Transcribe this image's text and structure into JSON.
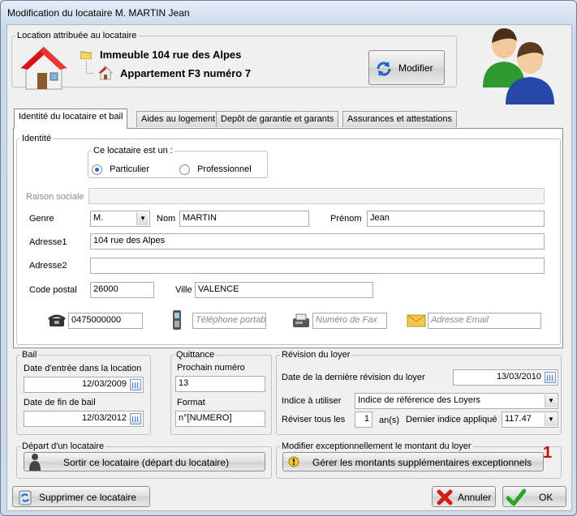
{
  "window": {
    "title": "Modification du locataire M. MARTIN Jean"
  },
  "location": {
    "legend": "Location attribuée au locataire",
    "building": "Immeuble 104 rue des Alpes",
    "apartment": "Appartement F3 numéro 7",
    "modify_label": "Modifier"
  },
  "tabs": [
    "Identité du locataire et bail",
    "Aides au logement",
    "Depôt de garantie et garants",
    "Assurances et attestations"
  ],
  "identite": {
    "legend": "Identité",
    "type_legend": "Ce locataire est un :",
    "opt_particulier": "Particulier",
    "opt_professionnel": "Professionnel",
    "raison_label": "Raison sociale",
    "genre_label": "Genre",
    "genre_value": "M.",
    "nom_label": "Nom",
    "nom_value": "MARTIN",
    "prenom_label": "Prénom",
    "prenom_value": "Jean",
    "adresse1_label": "Adresse1",
    "adresse1_value": "104 rue des Alpes",
    "adresse2_label": "Adresse2",
    "adresse2_value": "",
    "cp_label": "Code postal",
    "cp_value": "26000",
    "ville_label": "Ville",
    "ville_value": "VALENCE",
    "phone_value": "0475000000",
    "mobile_placeholder": "Téléphone portab",
    "fax_placeholder": "Numéro de Fax",
    "email_placeholder": "Adresse Email"
  },
  "bail": {
    "legend": "Bail",
    "entree_label": "Date d'entrée dans la location",
    "entree_value": "12/03/2009",
    "fin_label": "Date de fin de bail",
    "fin_value": "12/03/2012"
  },
  "quittance": {
    "legend": "Quittance",
    "prochain_label": "Prochain numéro",
    "prochain_value": "13",
    "format_label": "Format",
    "format_value": "n°[NUMERO]"
  },
  "revision": {
    "legend": "Révision du loyer",
    "derniere_label": "Date de la dernière révision du loyer",
    "derniere_value": "13/03/2010",
    "indice_label": "Indice à utiliser",
    "indice_value": "Indice de référence des Loyers",
    "reviser_label": "Réviser tous les",
    "reviser_value": "1",
    "unit": "an(s)",
    "dernier_indice_label": "Dernier indice appliqué",
    "dernier_indice_value": "117.47"
  },
  "depart": {
    "legend": "Départ d'un locataire",
    "button": "Sortir ce locataire (départ du locataire)"
  },
  "montant": {
    "legend": "Modifier exceptionnellement le montant du loyer",
    "button": "Gérer les montants supplémentaires exceptionnels",
    "badge": "1"
  },
  "footer": {
    "delete_label": "Supprimer ce locataire",
    "cancel_label": "Annuler",
    "ok_label": "OK"
  },
  "colors": {
    "accent": "#1f67c4",
    "badge": "#d00000"
  }
}
